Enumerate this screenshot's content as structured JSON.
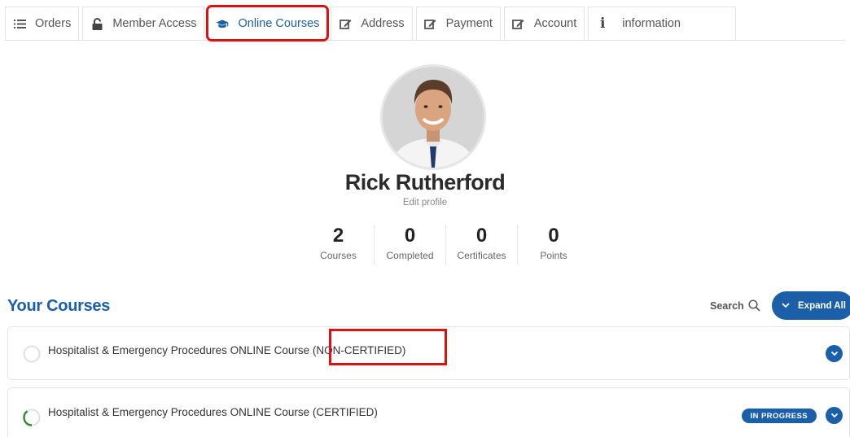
{
  "tabs": [
    {
      "label": "Orders",
      "icon": "list-icon"
    },
    {
      "label": "Member Access",
      "icon": "lock-icon"
    },
    {
      "label": "Online Courses",
      "icon": "graduation-cap-icon",
      "active": true
    },
    {
      "label": "Address",
      "icon": "edit-icon"
    },
    {
      "label": "Payment",
      "icon": "edit-icon"
    },
    {
      "label": "Account",
      "icon": "edit-icon"
    },
    {
      "label": "information",
      "icon": "info-icon"
    }
  ],
  "profile": {
    "name": "Rick Rutherford",
    "edit_label": "Edit profile"
  },
  "stats": [
    {
      "value": "2",
      "label": "Courses"
    },
    {
      "value": "0",
      "label": "Completed"
    },
    {
      "value": "0",
      "label": "Certificates"
    },
    {
      "value": "0",
      "label": "Points"
    }
  ],
  "courses_section": {
    "title": "Your Courses",
    "search_label": "Search",
    "expand_label": "Expand All"
  },
  "courses": [
    {
      "title": "Hospitalist & Emergency Procedures ONLINE Course (NON-CERTIFIED)",
      "status": "",
      "progress": 0
    },
    {
      "title": "Hospitalist & Emergency Procedures ONLINE Course (CERTIFIED)",
      "status": "IN PROGRESS",
      "progress": 0.4
    }
  ],
  "colors": {
    "accent": "#1a5fa8",
    "highlight": "#e01010",
    "progress": "#2e8b2e"
  }
}
